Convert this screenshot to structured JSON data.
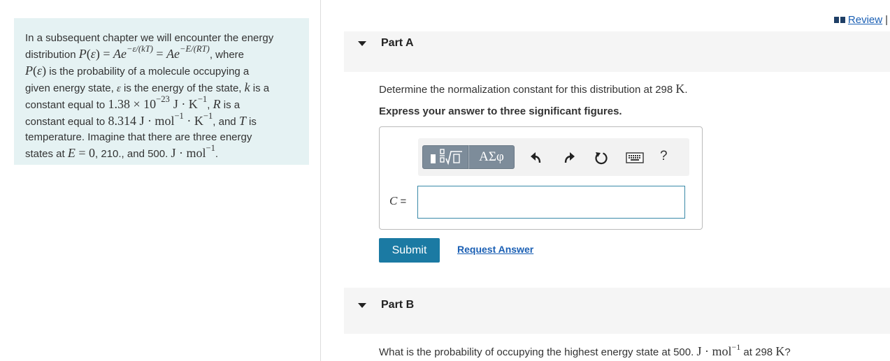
{
  "problem": {
    "line1": "In a subsequent chapter we will encounter the energy",
    "line2_prefix": "distribution",
    "line2_P": "P",
    "line2_eps": "ε",
    "line2_A1": "Ae",
    "line2_exp1": "−ε/(kT)",
    "line2_A2": "Ae",
    "line2_exp2": "−E/(RT)",
    "line2_suffix": ", where",
    "line3_P": "P",
    "line3_eps": "ε",
    "line3_suffix": "is the probability of a molecule occupying a",
    "line4_prefix": "given energy state,",
    "line4_eps": "ε",
    "line4_mid": "is the energy of the state,",
    "line4_k": "k",
    "line4_suffix": "is a",
    "line5_prefix": "constant equal to",
    "line5_value": "1.38 × 10",
    "line5_exp": "−23",
    "line5_unit1": "J · K",
    "line5_exp2": "−1",
    "line5_R": "R",
    "line5_suffix": "is a",
    "line6_prefix": "constant equal to",
    "line6_value": "8.314 J · mol",
    "line6_exp": "−1",
    "line6_unit": " · K",
    "line6_exp2": "−1",
    "line6_and": ", and",
    "line6_T": "T",
    "line6_suffix": "is",
    "line7": "temperature. Imagine that there are three energy",
    "line8_prefix": "states at",
    "line8_E": "E",
    "line8_eq": " = 0",
    "line8_mid": ", 210., and 500.",
    "line8_unit": "J · mol",
    "line8_exp": "−1"
  },
  "header": {
    "review_label": "Review",
    "review_sep": "|"
  },
  "partA": {
    "title": "Part A",
    "question_prefix": "Determine the normalization constant for this distribution at 298",
    "question_unit": "K",
    "question_suffix": ".",
    "instruction": "Express your answer to three significant figures.",
    "greek_label": "ΑΣφ",
    "help_label": "?",
    "var_label": "C",
    "var_eq": " =",
    "input_value": "",
    "submit_label": "Submit",
    "request_label": "Request Answer"
  },
  "partB": {
    "title": "Part B",
    "question_prefix": "What is the probability of occupying the highest energy state at 500.",
    "question_unit": "J · mol",
    "question_exp": "−1",
    "question_mid": "at 298",
    "question_unit2": "K",
    "question_suffix": "?"
  },
  "colors": {
    "problem_bg": "#e5f2f3",
    "part_header_bg": "#f5f5f5",
    "submit_bg": "#1b7aa3",
    "link": "#1a5fb4",
    "toolbar_button": "#7d8c9a",
    "input_border": "#3a89a8"
  },
  "icons": {
    "template": "template-fraction-root-icon",
    "undo": "undo-icon",
    "redo": "redo-icon",
    "reset": "reset-icon",
    "keyboard": "keyboard-icon",
    "help": "help-icon",
    "review": "book-icon",
    "caret": "caret-down-icon"
  }
}
